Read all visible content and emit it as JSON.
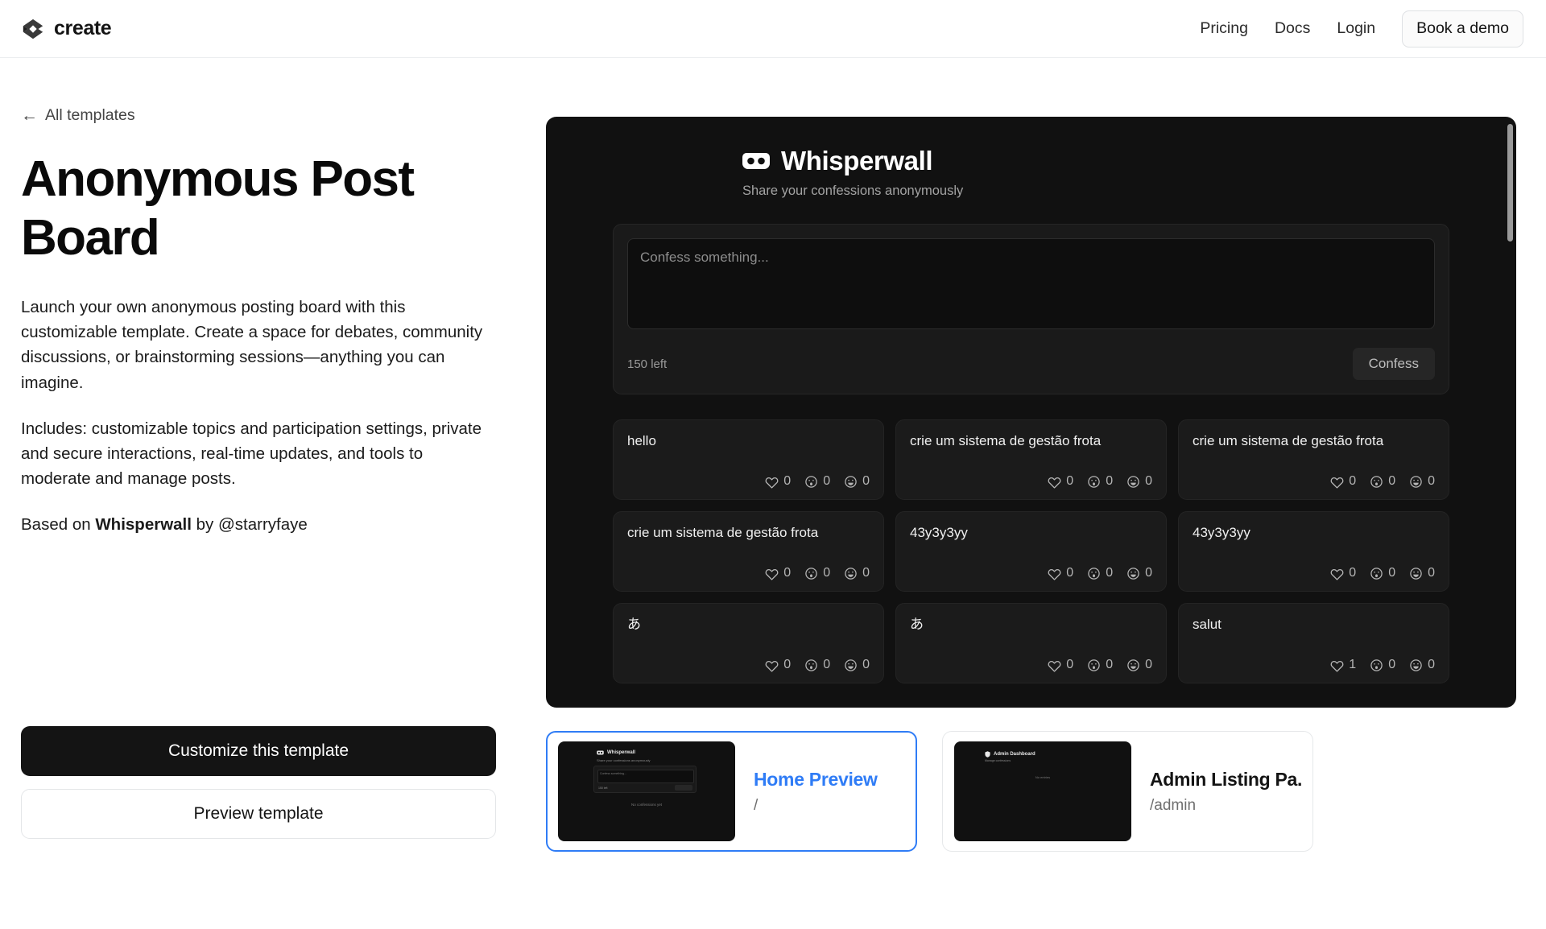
{
  "header": {
    "brand": "create",
    "brand_icon": "create-logo-icon",
    "nav": [
      {
        "label": "Pricing"
      },
      {
        "label": "Docs"
      },
      {
        "label": "Login"
      }
    ],
    "demo_button": "Book a demo"
  },
  "left": {
    "back_label": "All templates",
    "back_icon": "arrow-left-icon",
    "title": "Anonymous Post Board",
    "paragraph1": "Launch your own anonymous posting board with this customizable template. Create a space for debates, community discussions, or brainstorming sessions—anything you can imagine.",
    "paragraph2": "Includes: customizable topics and participation settings, private and secure interactions, real-time updates, and tools to moderate and manage posts.",
    "based_on_prefix": "Based on ",
    "based_on_name": "Whisperwall",
    "based_on_suffix": " by @starryfaye",
    "primary_cta": "Customize this template",
    "secondary_cta": "Preview template"
  },
  "preview": {
    "app_title": "Whisperwall",
    "app_icon": "mask-icon",
    "app_subtitle": "Share your confessions anonymously",
    "compose": {
      "placeholder": "Confess something...",
      "value": "",
      "chars_left": "150 left",
      "submit_label": "Confess"
    },
    "reaction_icons": [
      "heart-icon",
      "surprised-face-icon",
      "smiling-face-icon"
    ],
    "posts": [
      {
        "text": "hello",
        "reactions": [
          "0",
          "0",
          "0"
        ]
      },
      {
        "text": "crie um sistema de gestão frota",
        "reactions": [
          "0",
          "0",
          "0"
        ]
      },
      {
        "text": "crie um sistema de gestão frota",
        "reactions": [
          "0",
          "0",
          "0"
        ]
      },
      {
        "text": "crie um sistema de gestão frota",
        "reactions": [
          "0",
          "0",
          "0"
        ]
      },
      {
        "text": "43y3y3yy",
        "reactions": [
          "0",
          "0",
          "0"
        ]
      },
      {
        "text": "43y3y3yy",
        "reactions": [
          "0",
          "0",
          "0"
        ]
      },
      {
        "text": "あ",
        "reactions": [
          "0",
          "0",
          "0"
        ]
      },
      {
        "text": "あ",
        "reactions": [
          "0",
          "0",
          "0"
        ]
      },
      {
        "text": "salut",
        "reactions": [
          "1",
          "0",
          "0"
        ]
      }
    ]
  },
  "thumbs": [
    {
      "name": "Home Preview",
      "path": "/",
      "active": true,
      "mini": {
        "title": "Whisperwall",
        "subtitle": "Share your confessions anonymously",
        "placeholder": "Confess something...",
        "chars_left": "150 left",
        "empty": "No confessions yet"
      }
    },
    {
      "name": "Admin Listing Pa...",
      "path": "/admin",
      "active": false,
      "mini": {
        "title": "Admin Dashboard",
        "subtitle": "Manage confessions",
        "empty": "No entries"
      }
    }
  ],
  "colors": {
    "accent_blue": "#2f7cf6",
    "dark_panel": "#111111",
    "ink": "#141414"
  }
}
